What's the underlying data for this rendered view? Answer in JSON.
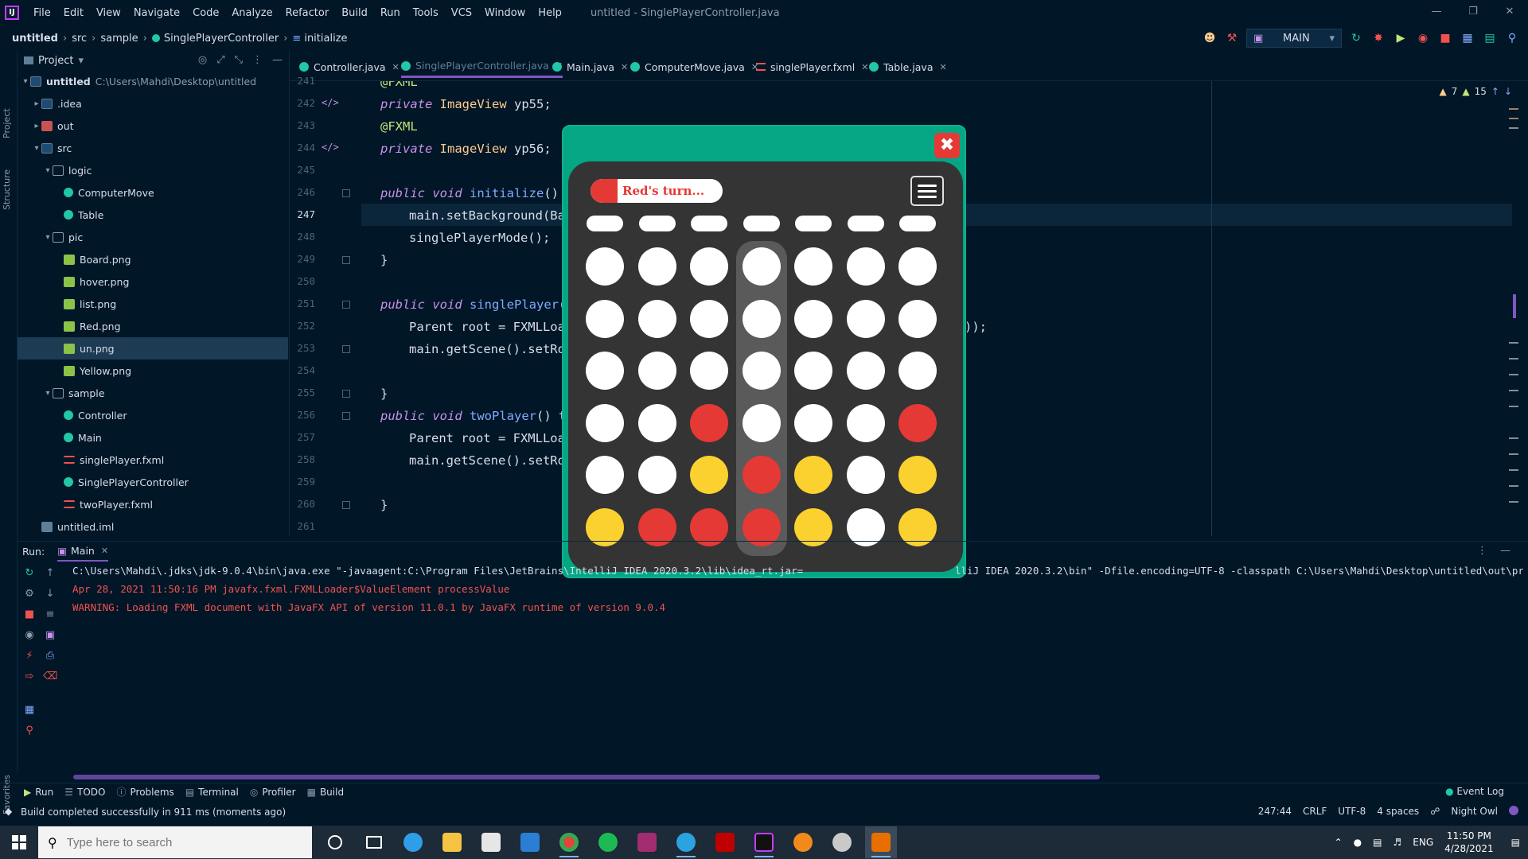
{
  "menubar": {
    "items": [
      "File",
      "Edit",
      "View",
      "Navigate",
      "Code",
      "Analyze",
      "Refactor",
      "Build",
      "Run",
      "Tools",
      "VCS",
      "Window",
      "Help"
    ],
    "window_title": "untitled - SinglePlayerController.java"
  },
  "navbar": {
    "crumbs": [
      "untitled",
      "src",
      "sample",
      "SinglePlayerController",
      "initialize"
    ],
    "run_config": "MAIN"
  },
  "left_strip": {
    "project": "Project",
    "structure": "Structure",
    "favorites": "Favorites"
  },
  "project_panel": {
    "title": "Project",
    "root_path": "C:\\Users\\Mahdi\\Desktop\\untitled",
    "tree": [
      {
        "label": "untitled",
        "icon": "folder-icon",
        "bold": true
      },
      {
        "label": ".idea",
        "icon": "folder-icon"
      },
      {
        "label": "out",
        "icon": "folder-icon"
      },
      {
        "label": "src",
        "icon": "folder-icon"
      },
      {
        "label": "logic",
        "icon": "package-icon"
      },
      {
        "label": "ComputerMove",
        "icon": "class-icon"
      },
      {
        "label": "Table",
        "icon": "class-icon"
      },
      {
        "label": "pic",
        "icon": "package-icon"
      },
      {
        "label": "Board.png",
        "icon": "image-icon"
      },
      {
        "label": "hover.png",
        "icon": "image-icon"
      },
      {
        "label": "list.png",
        "icon": "image-icon"
      },
      {
        "label": "Red.png",
        "icon": "image-icon"
      },
      {
        "label": "un.png",
        "icon": "image-icon",
        "selected": true
      },
      {
        "label": "Yellow.png",
        "icon": "image-icon"
      },
      {
        "label": "sample",
        "icon": "package-icon"
      },
      {
        "label": "Controller",
        "icon": "class-icon"
      },
      {
        "label": "Main",
        "icon": "class-icon"
      },
      {
        "label": "singlePlayer.fxml",
        "icon": "fxml-icon"
      },
      {
        "label": "SinglePlayerController",
        "icon": "class-icon"
      },
      {
        "label": "twoPlayer.fxml",
        "icon": "fxml-icon"
      },
      {
        "label": "untitled.iml",
        "icon": "module-icon"
      }
    ]
  },
  "editor": {
    "tabs": [
      {
        "label": "Controller.java",
        "active": false
      },
      {
        "label": "SinglePlayerController.java",
        "active": true
      },
      {
        "label": "Main.java",
        "active": false
      },
      {
        "label": "ComputerMove.java",
        "active": false
      },
      {
        "label": "singlePlayer.fxml",
        "active": false
      },
      {
        "label": "Table.java",
        "active": false
      }
    ],
    "line_numbers": [
      "241",
      "242",
      "243",
      "244",
      "245",
      "246",
      "247",
      "248",
      "249",
      "250",
      "251",
      "252",
      "253",
      "254",
      "255",
      "256",
      "257",
      "258",
      "259",
      "260",
      "261"
    ],
    "current_line": "247",
    "code": {
      "l241": "@FXML",
      "l242_kw": "private",
      "l242_ty": "ImageView",
      "l242_rest": " yp55;",
      "l243": "@FXML",
      "l244_kw": "private",
      "l244_ty": "ImageView",
      "l244_rest": " yp56;",
      "l246_kw": "public void",
      "l246_fn": "initialize",
      "l246_rest": "() {",
      "l247": "main.setBackground(Ba",
      "l248": "singlePlayerMode();",
      "l249": "}",
      "l251_kw": "public void",
      "l251_fn": "singlePlayer",
      "l251_rest": "(",
      "l252_a": "Parent root = FXMLLoa",
      "l252_b": "));",
      "l253": "main.getScene().setRo",
      "l255": "}",
      "l256_kw": "public void",
      "l256_fn": "twoPlayer",
      "l256_rest": "() t",
      "l257": "Parent root = FXMLLoa",
      "l258": "main.getScene().setRo",
      "l260": "}"
    },
    "inspections": {
      "warnings": "7",
      "weak_warnings": "15"
    }
  },
  "game": {
    "turn_text": "Red's turn...",
    "columns": 7,
    "highlight_column": 3,
    "grid": [
      [
        "empty",
        "empty",
        "empty",
        "empty",
        "empty",
        "empty",
        "empty"
      ],
      [
        "empty",
        "empty",
        "empty",
        "empty",
        "empty",
        "empty",
        "empty"
      ],
      [
        "empty",
        "empty",
        "empty",
        "empty",
        "empty",
        "empty",
        "empty"
      ],
      [
        "empty",
        "empty",
        "red",
        "empty",
        "empty",
        "empty",
        "red"
      ],
      [
        "empty",
        "empty",
        "yellow",
        "red",
        "yellow",
        "empty",
        "yellow"
      ],
      [
        "yellow",
        "red",
        "red",
        "red",
        "yellow",
        "empty",
        "yellow"
      ]
    ],
    "colors": {
      "red": "#e53935",
      "yellow": "#fbd130",
      "empty": "#ffffff",
      "board": "#343434",
      "frame": "#04a684"
    }
  },
  "run_panel": {
    "label": "Run:",
    "tab": "Main",
    "lines": [
      {
        "text": "C:\\Users\\Mahdi\\.jdks\\jdk-9.0.4\\bin\\java.exe \"-javaagent:C:\\Program Files\\JetBrains\\IntelliJ IDEA 2020.3.2\\lib\\idea_rt.jar=                 ",
        "kind": "cmd"
      },
      {
        "text": "Apr 28, 2021 11:50:16 PM javafx.fxml.FXMLLoader$ValueElement processValue",
        "kind": "err"
      },
      {
        "text": "WARNING: Loading FXML document with JavaFX API of version 11.0.1 by JavaFX runtime of version 9.0.4",
        "kind": "err"
      }
    ],
    "cmd_tail": "lliJ IDEA 2020.3.2\\bin\" -Dfile.encoding=UTF-8 -classpath C:\\Users\\Mahdi\\Desktop\\untitled\\out\\produ"
  },
  "toolwindows": [
    "Run",
    "TODO",
    "Problems",
    "Terminal",
    "Profiler",
    "Build"
  ],
  "event_log": "Event Log",
  "status": {
    "message": "Build completed successfully in 911 ms (moments ago)",
    "position": "247:44",
    "line_sep": "CRLF",
    "encoding": "UTF-8",
    "indent": "4 spaces",
    "theme": "Night Owl"
  },
  "taskbar": {
    "search_placeholder": "Type here to search",
    "lang": "ENG",
    "time": "11:50 PM",
    "date": "4/28/2021"
  }
}
